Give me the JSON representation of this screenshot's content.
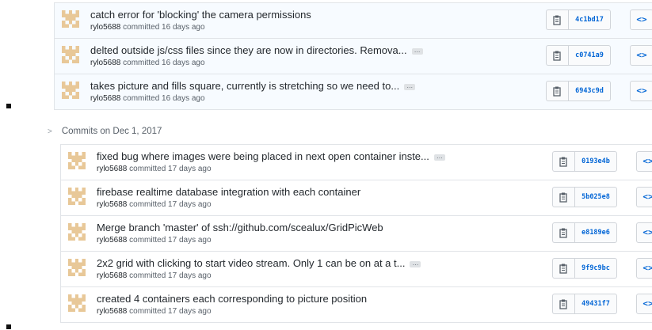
{
  "groups": [
    {
      "commits": [
        {
          "message": "catch error for 'blocking' the camera permissions",
          "truncated": false,
          "author": "rylo5688",
          "time": "committed 16 days ago",
          "sha": "4c1bd17"
        },
        {
          "message": "delted outside js/css files since they are now in directories. Remova...",
          "truncated": true,
          "author": "rylo5688",
          "time": "committed 16 days ago",
          "sha": "c0741a9"
        },
        {
          "message": "takes picture and fills square, currently is stretching so we need to...",
          "truncated": true,
          "author": "rylo5688",
          "time": "committed 16 days ago",
          "sha": "6943c9d"
        }
      ]
    },
    {
      "date_label": "Commits on Dec 1, 2017",
      "commits": [
        {
          "message": "fixed bug where images were being placed in next open container inste...",
          "truncated": true,
          "author": "rylo5688",
          "time": "committed 17 days ago",
          "sha": "0193e4b"
        },
        {
          "message": "firebase realtime database integration with each container",
          "truncated": false,
          "author": "rylo5688",
          "time": "committed 17 days ago",
          "sha": "5b025e8"
        },
        {
          "message": "Merge branch 'master' of ssh://github.com/scealux/GridPicWeb",
          "truncated": false,
          "author": "rylo5688",
          "time": "committed 17 days ago",
          "sha": "e8189e6"
        },
        {
          "message": "2x2 grid with clicking to start video stream. Only 1 can be on at a t...",
          "truncated": true,
          "author": "rylo5688",
          "time": "committed 17 days ago",
          "sha": "9f9c9bc"
        },
        {
          "message": "created 4 containers each corresponding to picture position",
          "truncated": false,
          "author": "rylo5688",
          "time": "committed 17 days ago",
          "sha": "49431f7"
        }
      ]
    }
  ],
  "icons": {
    "copy": "clipboard-icon",
    "browse": "code-icon",
    "expand": "ellipsis-icon",
    "avatar": "identicon-avatar"
  },
  "labels": {
    "ellipsis": "…",
    "browse_glyph": "<>"
  },
  "colors": {
    "sha": "#0366d6",
    "highlight_row": "#f7fbff",
    "avatar": "#e8c898"
  }
}
